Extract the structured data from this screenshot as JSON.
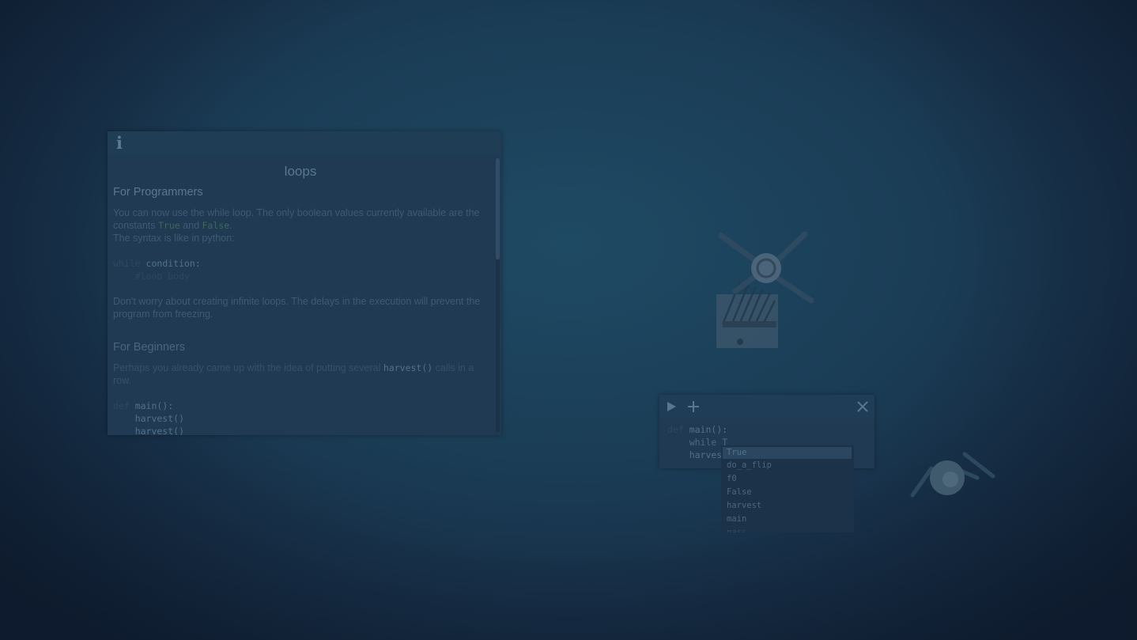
{
  "info_panel": {
    "title": "loops",
    "section1_heading": "For Programmers",
    "p1_a": "You can now use the while loop. The only boolean values currently available are the constants ",
    "p1_true": "True",
    "p1_and": " and ",
    "p1_false": "False",
    "p1_end": ".",
    "p1_b": "The syntax is like in python:",
    "code1_kw": "while",
    "code1_rest": " condition:",
    "code1_body": "    #loop body",
    "p2": "Don't worry about creating infinite loops. The delays in the execution will prevent the program from freezing.",
    "section2_heading": "For Beginners",
    "p3_a": "Perhaps you already came up with the idea of putting several ",
    "p3_code": "harvest()",
    "p3_b": " calls in a row.",
    "code2_kw": "def",
    "code2_rest": " main():",
    "code2_l2": "    harvest()",
    "code2_l3": "    harvest()"
  },
  "editor": {
    "line1_kw": "def",
    "line1_rest": " main():",
    "line2": "    while T",
    "line3": "    harvest"
  },
  "autocomplete": {
    "items": [
      "True",
      "do_a_flip",
      "f0",
      "False",
      "harvest",
      "main",
      "pass"
    ]
  },
  "icons": {
    "info": "info-icon",
    "run": "play-icon",
    "add": "plus-icon",
    "close": "close-icon"
  }
}
